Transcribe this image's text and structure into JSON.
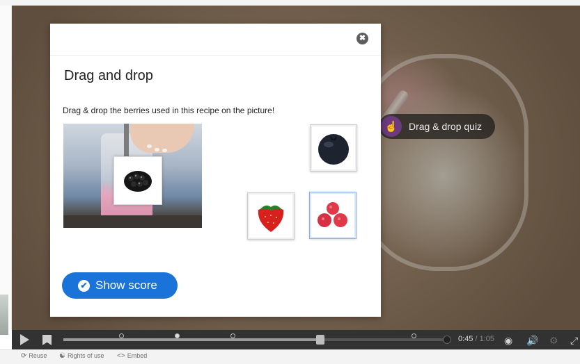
{
  "dialog": {
    "title": "Drag and drop",
    "task": "Drag & drop the berries used in this recipe on the picture!",
    "close_icon": "✖",
    "score_button": {
      "label": "Show score",
      "icon": "✔"
    }
  },
  "draggables": [
    {
      "name": "blueberry",
      "color": "#1d2430",
      "selected": false
    },
    {
      "name": "strawberry",
      "color": "#d8201e",
      "selected": false
    },
    {
      "name": "raspberry",
      "color": "#e03a4a",
      "selected": true
    }
  ],
  "dropped": {
    "name": "blackberry",
    "color": "#151515"
  },
  "hotspot": {
    "label": "Drag & drop quiz",
    "icon": "hand-pointer-icon"
  },
  "player": {
    "current_time": "0:45",
    "separator": "/",
    "duration": "1:05",
    "progress": 0.69
  },
  "footer": {
    "reuse": "Reuse",
    "rights": "Rights of use",
    "embed": "Embed"
  },
  "colors": {
    "accent": "#1a73d9",
    "hotspot_icon_bg": "#6b3a7f",
    "control_bar": "#323232"
  }
}
